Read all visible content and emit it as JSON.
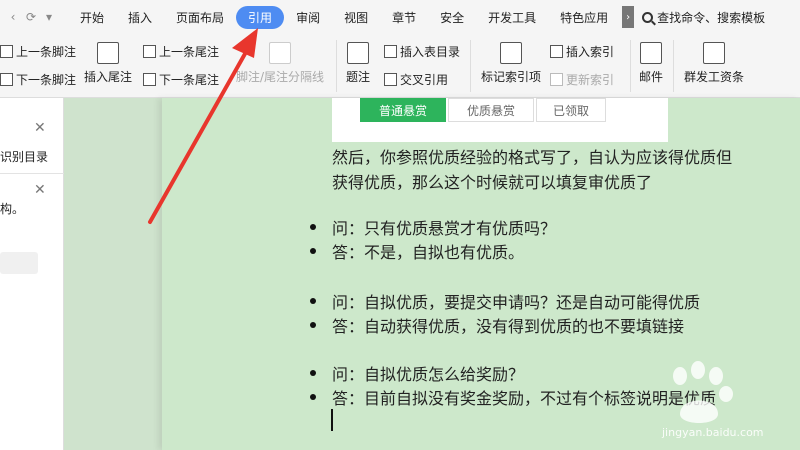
{
  "menubar": {
    "quick_access": [
      "‹",
      "⟳",
      "▾"
    ],
    "tabs": [
      "开始",
      "插入",
      "页面布局",
      "引用",
      "审阅",
      "视图",
      "章节",
      "安全",
      "开发工具",
      "特色应用"
    ],
    "active_tab": "引用",
    "more": "›",
    "search_label": "查找命令、搜索模板"
  },
  "ribbon": {
    "prev_footnote": "上一条脚注",
    "next_footnote": "下一条脚注",
    "insert_endnote": "插入尾注",
    "prev_endnote": "上一条尾注",
    "next_endnote": "下一条尾注",
    "footnote_sep": "脚注/尾注分隔线",
    "caption": "题注",
    "insert_table_of_figures": "插入表目录",
    "cross_reference": "交叉引用",
    "mark_index_entry": "标记索引项",
    "insert_index": "插入索引",
    "update_index": "更新索引",
    "mail": "邮件",
    "payroll": "群发工资条"
  },
  "leftpane": {
    "line1": "识别目录",
    "line2": "构。"
  },
  "webbox": {
    "tab1": "普通悬赏",
    "tab2": "优质悬赏",
    "tab3": "已领取"
  },
  "document": {
    "para1_line1": "然后，你参照优质经验的格式写了，自认为应该得优质但",
    "para1_line2": "获得优质，那么这个时候就可以填复审优质了",
    "qa": [
      "问：只有优质悬赏才有优质吗？",
      "答：不是，自拟也有优质。",
      "问：自拟优质，要提交申请吗？还是自动可能得优质",
      "答：自动获得优质，没有得到优质的也不要填链接",
      "问：自拟优质怎么给奖励？",
      "答：目前自拟没有奖金奖励，不过有个标签说明是优质"
    ]
  },
  "watermark": {
    "text": "jingyan.baidu.com"
  },
  "colors": {
    "active_tab": "#4e8cf2",
    "page_bg": "#cde8cb",
    "arrow": "#e8362d",
    "green_tab": "#2db45c"
  }
}
